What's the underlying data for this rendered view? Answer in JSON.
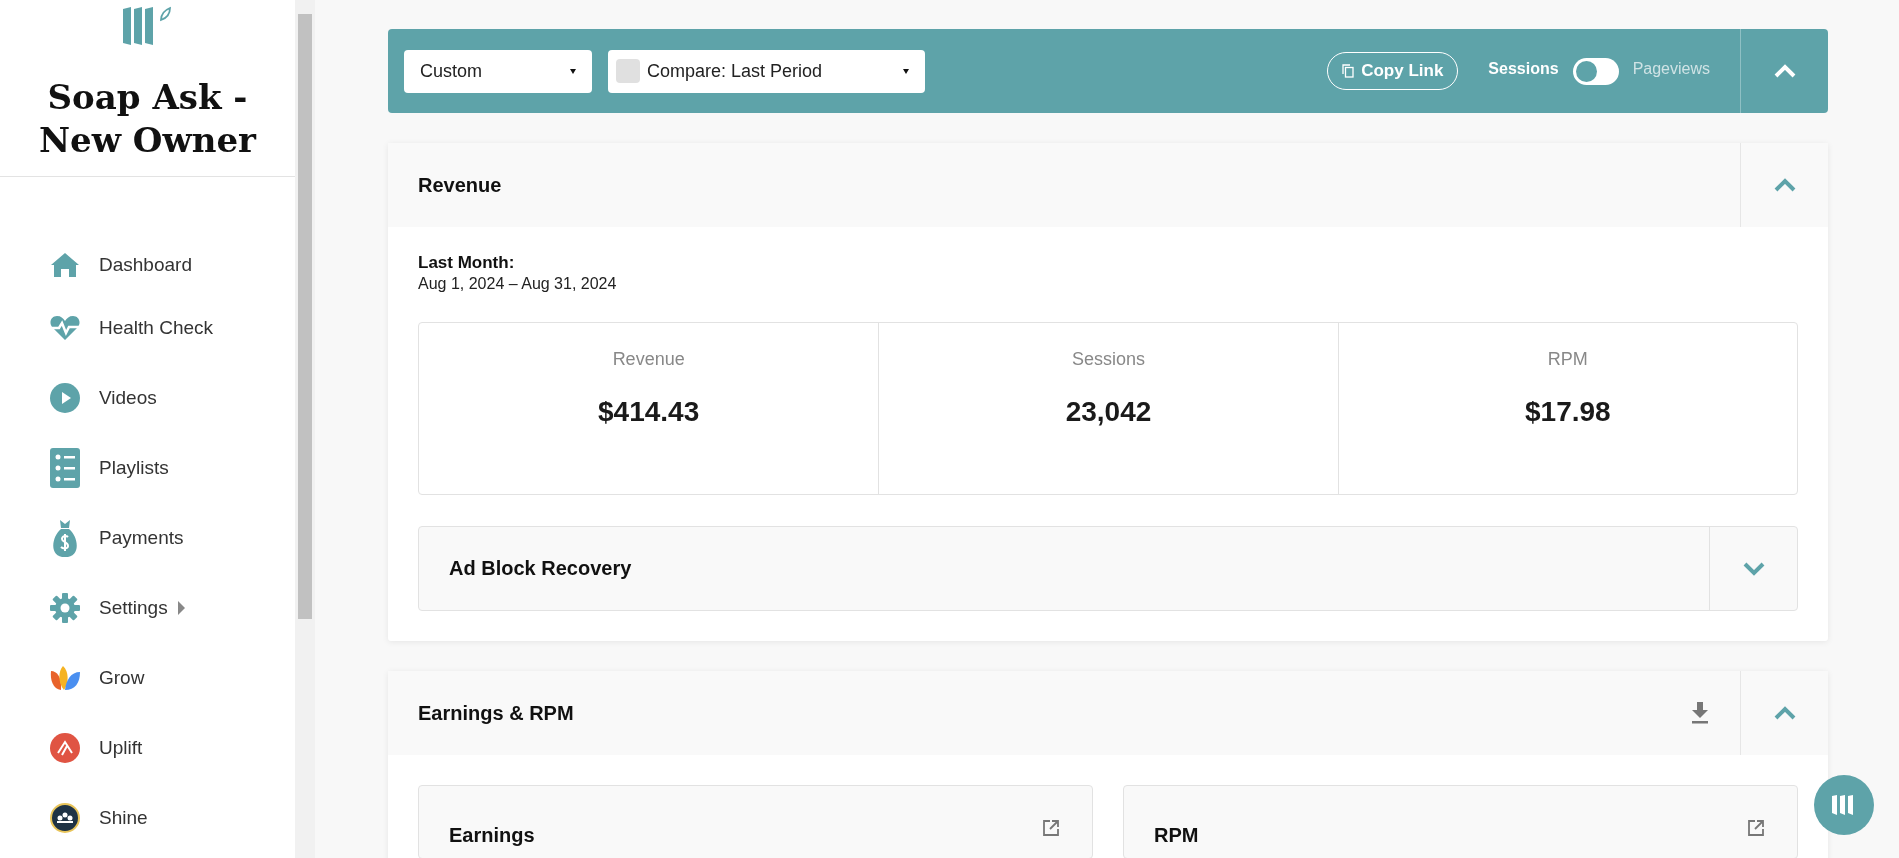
{
  "sidebar": {
    "title": "Soap Ask - New Owner",
    "items": [
      {
        "label": "Dashboard",
        "has_submenu": false
      },
      {
        "label": "Health Check",
        "has_submenu": false
      },
      {
        "label": "Videos",
        "has_submenu": false
      },
      {
        "label": "Playlists",
        "has_submenu": false
      },
      {
        "label": "Payments",
        "has_submenu": false
      },
      {
        "label": "Settings",
        "has_submenu": true
      },
      {
        "label": "Grow",
        "has_submenu": false
      },
      {
        "label": "Uplift",
        "has_submenu": false
      },
      {
        "label": "Shine",
        "has_submenu": false
      }
    ]
  },
  "toolbar": {
    "date_range": "Custom",
    "compare": {
      "label": "Compare: Last Period",
      "checked": false
    },
    "copy_link": "Copy Link",
    "metric_toggle": [
      {
        "label": "Sessions",
        "selected": true
      },
      {
        "label": "Pageviews",
        "selected": false
      }
    ],
    "expanded": true
  },
  "revenue_panel": {
    "title": "Revenue",
    "expanded": true,
    "period_label": "Last Month:",
    "period_dates": "Aug 1, 2024 – Aug 31, 2024",
    "stats": [
      {
        "label": "Revenue",
        "value": "$414.43"
      },
      {
        "label": "Sessions",
        "value": "23,042"
      },
      {
        "label": "RPM",
        "value": "$17.98"
      }
    ],
    "sub_panel": {
      "title": "Ad Block Recovery",
      "expanded": false
    }
  },
  "earnings_panel": {
    "title": "Earnings & RPM",
    "expanded": true,
    "cards": [
      {
        "title": "Earnings"
      },
      {
        "title": "RPM"
      }
    ]
  }
}
